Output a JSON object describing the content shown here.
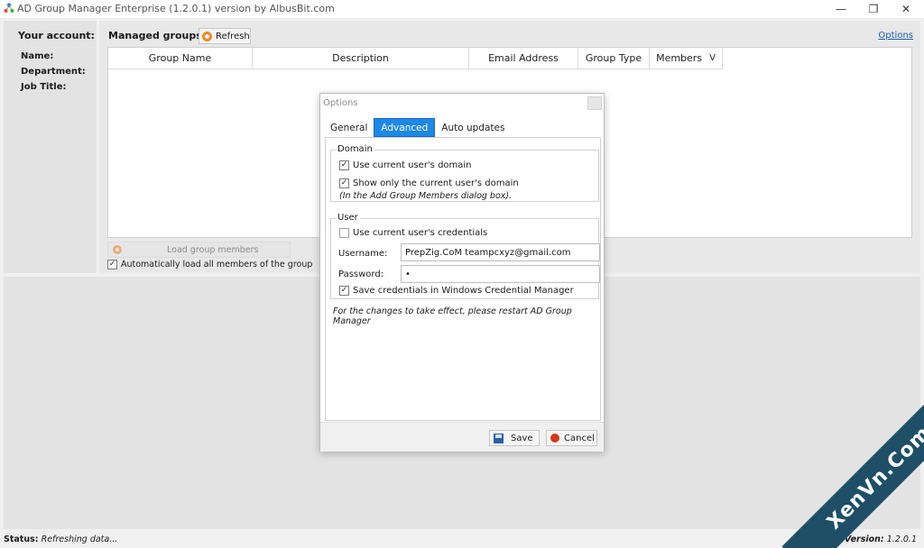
{
  "window": {
    "title": "AD Group Manager Enterprise (1.2.0.1) version by AlbusBit.com",
    "minimize_glyph": "—",
    "restore_glyph": "❐",
    "close_glyph": "✕"
  },
  "account": {
    "title": "Your account:",
    "name_label": "Name:",
    "department_label": "Department:",
    "job_title_label": "Job Title:"
  },
  "main": {
    "managed_groups_label": "Managed groups:",
    "refresh_label": "Refresh",
    "options_link": "Options",
    "columns": [
      "Group Name",
      "Description",
      "Email Address",
      "Group Type",
      "Members"
    ],
    "sort_glyph": "V",
    "load_members_label": "Load group members",
    "auto_load_label": "Automatically load all members of the group",
    "auto_load_checked": true
  },
  "dialog": {
    "title": "Options",
    "tabs": [
      "General",
      "Advanced",
      "Auto updates"
    ],
    "active_tab": "Advanced",
    "domain": {
      "legend": "Domain",
      "use_current_domain_label": "Use current user's domain",
      "use_current_domain_checked": true,
      "show_only_domain_label": "Show only the current user's domain",
      "show_only_domain_checked": true,
      "show_only_note": "(In the Add Group Members dialog box)."
    },
    "user": {
      "legend": "User",
      "use_credentials_label": "Use current user's credentials",
      "use_credentials_checked": false,
      "username_label": "Username:",
      "username_value": "PrepZig.CoM  teampcxyz@gmail.com",
      "password_label": "Password:",
      "password_value": "•",
      "save_credentials_label": "Save credentials in Windows Credential Manager",
      "save_credentials_checked": true
    },
    "restart_note": "For the changes to take effect, please restart AD Group Manager",
    "save_label": "Save",
    "cancel_label": "Cancel"
  },
  "status": {
    "status_label": "Status:",
    "status_text": "Refreshing data...",
    "version_label": "Version:",
    "version_value": "1.2.0.1"
  },
  "watermark": {
    "text": "XenVn.Com",
    "color": "#1e4f66"
  },
  "colors": {
    "accent": "#1e88e5",
    "link": "#1a5fb4",
    "refresh_icon": "#f08a24",
    "cancel_icon": "#d33a1a"
  },
  "icons": {
    "app": "network-icon",
    "refresh": "refresh-icon",
    "save": "floppy-disk-icon",
    "cancel": "stop-icon",
    "check": "✓"
  }
}
